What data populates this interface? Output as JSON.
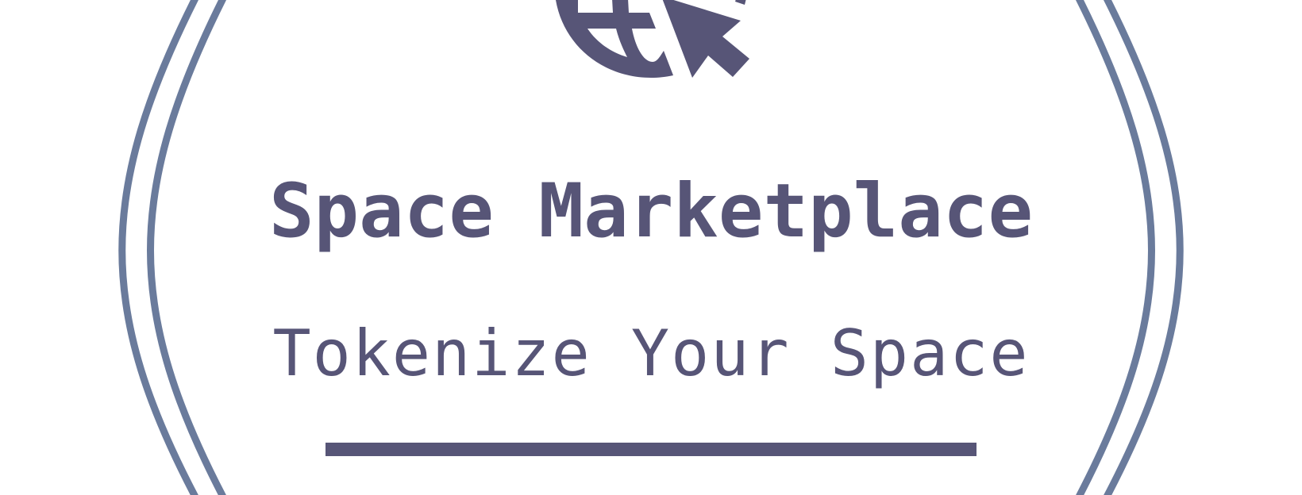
{
  "logo": {
    "title": "Space Marketplace",
    "tagline": "Tokenize Your Space",
    "icons": [
      "globe-icon",
      "cursor-arrow-icon"
    ]
  },
  "colors": {
    "text": "#575577",
    "ring": "#6a7b9c",
    "background": "#ffffff"
  }
}
